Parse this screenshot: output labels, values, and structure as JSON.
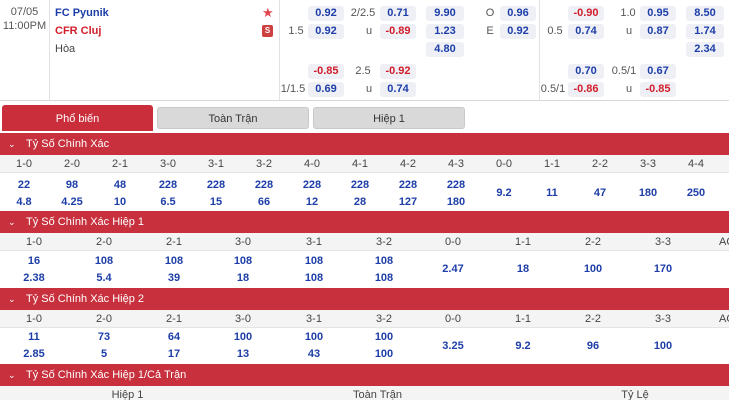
{
  "match": {
    "date": "07/05",
    "time": "11:00PM",
    "home": "FC Pyunik",
    "away": "CFR Cluj",
    "draw": "Hòa",
    "star_icon": "star-icon",
    "s_badge": "S",
    "odds": {
      "hdp1_home": "0.92",
      "hdp1_line": "2/2.5",
      "hdp1_ou_over": "0.71",
      "eu_home": "9.90",
      "ou_o_label": "O",
      "ou_o": "0.96",
      "hdp1_line_b": "1.5",
      "hdp1_away": "0.92",
      "hdp1_u_label": "u",
      "hdp1_u": "-0.89",
      "eu_away": "1.23",
      "oe_e_label": "E",
      "oe_e": "0.92",
      "eu_draw": "4.80",
      "alt_home": "-0.85",
      "alt_line": "2.5",
      "alt_over": "-0.92",
      "alt_line_b": "1/1.5",
      "alt_away": "0.69",
      "alt_u_label": "u",
      "alt_under": "0.74",
      "h1_a": "-0.90",
      "h1_line": "1.0",
      "h1_b": "0.95",
      "h1_c": "8.50",
      "h1_line2": "0.5",
      "h1_d": "0.74",
      "h1_u_label": "u",
      "h1_e": "0.87",
      "h1_f": "1.74",
      "h1_g": "2.34",
      "h1_h": "0.70",
      "h1_line3": "0.5/1",
      "h1_i": "0.67",
      "h1_line4": "0.5/1",
      "h1_j": "-0.86",
      "h1_u_label2": "u",
      "h1_k": "-0.85"
    }
  },
  "tabs": [
    "Phổ biến",
    "Toàn Trận",
    "Hiệp 1"
  ],
  "sections": {
    "s1": {
      "title": "Tỷ Số Chính Xác",
      "headers": [
        "1-0",
        "2-0",
        "2-1",
        "3-0",
        "3-1",
        "3-2",
        "4-0",
        "4-1",
        "4-2",
        "4-3",
        "0-0",
        "1-1",
        "2-2",
        "3-3",
        "4-4"
      ],
      "row1": [
        "22",
        "98",
        "48",
        "228",
        "228",
        "228",
        "228",
        "228",
        "228",
        "228",
        "9.2",
        "11",
        "47",
        "180",
        "250"
      ],
      "row2": [
        "4.8",
        "4.25",
        "10",
        "6.5",
        "15",
        "66",
        "12",
        "28",
        "127",
        "180"
      ]
    },
    "s2": {
      "title": "Tỷ Số Chính Xác Hiệp 1",
      "headers": [
        "1-0",
        "2-0",
        "2-1",
        "3-0",
        "3-1",
        "3-2",
        "0-0",
        "1-1",
        "2-2",
        "3-3",
        "AO"
      ],
      "row1": [
        "16",
        "108",
        "108",
        "108",
        "108",
        "108",
        "2.47",
        "18",
        "100",
        "170"
      ],
      "row2": [
        "2.38",
        "5.4",
        "39",
        "18",
        "108",
        "108"
      ]
    },
    "s3": {
      "title": "Tỷ Số Chính Xác Hiệp 2",
      "headers": [
        "1-0",
        "2-0",
        "2-1",
        "3-0",
        "3-1",
        "3-2",
        "0-0",
        "1-1",
        "2-2",
        "3-3",
        "AO"
      ],
      "row1": [
        "11",
        "73",
        "64",
        "100",
        "100",
        "100",
        "3.25",
        "9.2",
        "96",
        "100"
      ],
      "row2": [
        "2.85",
        "5",
        "17",
        "13",
        "43",
        "100"
      ]
    },
    "s4": {
      "title": "Tỷ Số Chính Xác Hiệp 1/Cả Trận",
      "headers": [
        "Hiệp 1",
        "Toàn Trận",
        "Tỷ Lệ"
      ]
    }
  }
}
